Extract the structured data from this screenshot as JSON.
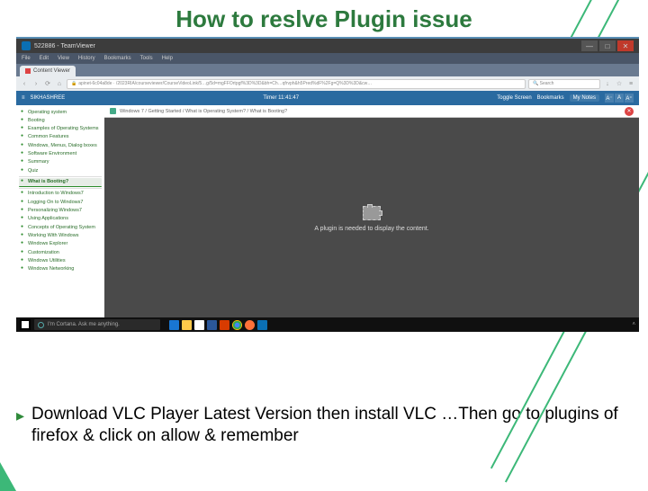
{
  "slide": {
    "title": "How to reslve Plugin issue",
    "bullet": "Download VLC Player Latest Version then install VLC …Then go to plugins of firefox & click on allow & remember"
  },
  "window": {
    "title": "522886 - TeamViewer"
  },
  "browser": {
    "menu": [
      "File",
      "Edit",
      "View",
      "History",
      "Bookmarks",
      "Tools",
      "Help"
    ],
    "tab": "Content Viewer",
    "url": "apinet-6c04a8de · /2023RIA/courseviewer/CourseVideoLink/5…g/5d=mgFFOrtpgf%3D%3D&bh=Ch…qfrvph&h5Pred%dF%2Fg=Q%3D%3D&cw…",
    "search_placeholder": "Search"
  },
  "appbar": {
    "menu_icon": "≡",
    "user": "SIKHASHREE",
    "timer": "Timer 11:41:47",
    "toggle": "Toggle Screen",
    "bookmarks": "Bookmarks",
    "notes": "My Notes"
  },
  "breadcrumb": "Windows 7 / Getting Started / What is Operating System? / What is Booting?",
  "plugin_message": "A plugin is needed to display the content.",
  "sidebar": {
    "items": [
      "Operating system",
      "Booting",
      "Examples of Operating Systems",
      "Common Features",
      "Windows, Menus, Dialog boxes",
      "Software Environment",
      "Summary",
      "Quiz",
      "What is Booting?",
      "Introduction to Windows7",
      "Logging On to Windows7",
      "Personalizing Windows7",
      "Using Applications",
      "Concepts of Operating System",
      "Working With Windows",
      "Windows Explorer",
      "Customization",
      "Windows Utilities",
      "Windows Networking"
    ],
    "active_index": 8
  },
  "taskbar": {
    "cortana": "I'm Cortana. Ask me anything."
  }
}
